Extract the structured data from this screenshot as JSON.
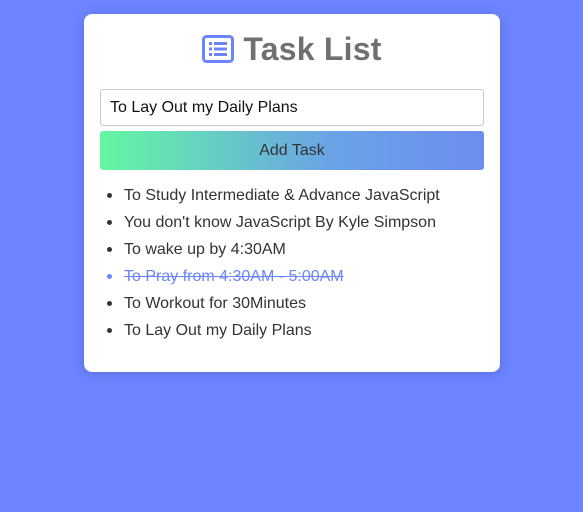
{
  "app": {
    "title": "Task List",
    "title_icon": "list-icon"
  },
  "colors": {
    "background": "#6c84fe",
    "card": "#ffffff",
    "title_text": "#707070",
    "icon_accent": "#6c84fe",
    "button_gradient_start": "#64f7a2",
    "button_gradient_end": "#6c8df0",
    "completed_task": "#6c84fe"
  },
  "form": {
    "input_value": "To Lay Out my Daily Plans",
    "add_button_label": "Add Task"
  },
  "tasks": [
    {
      "text": "To Study Intermediate & Advance JavaScript",
      "completed": false
    },
    {
      "text": "You don't know JavaScript By Kyle Simpson",
      "completed": false
    },
    {
      "text": "To wake up by 4:30AM",
      "completed": false
    },
    {
      "text": "To Pray from 4:30AM - 5:00AM",
      "completed": true
    },
    {
      "text": "To Workout for 30Minutes",
      "completed": false
    },
    {
      "text": "To Lay Out my Daily Plans",
      "completed": false
    }
  ]
}
